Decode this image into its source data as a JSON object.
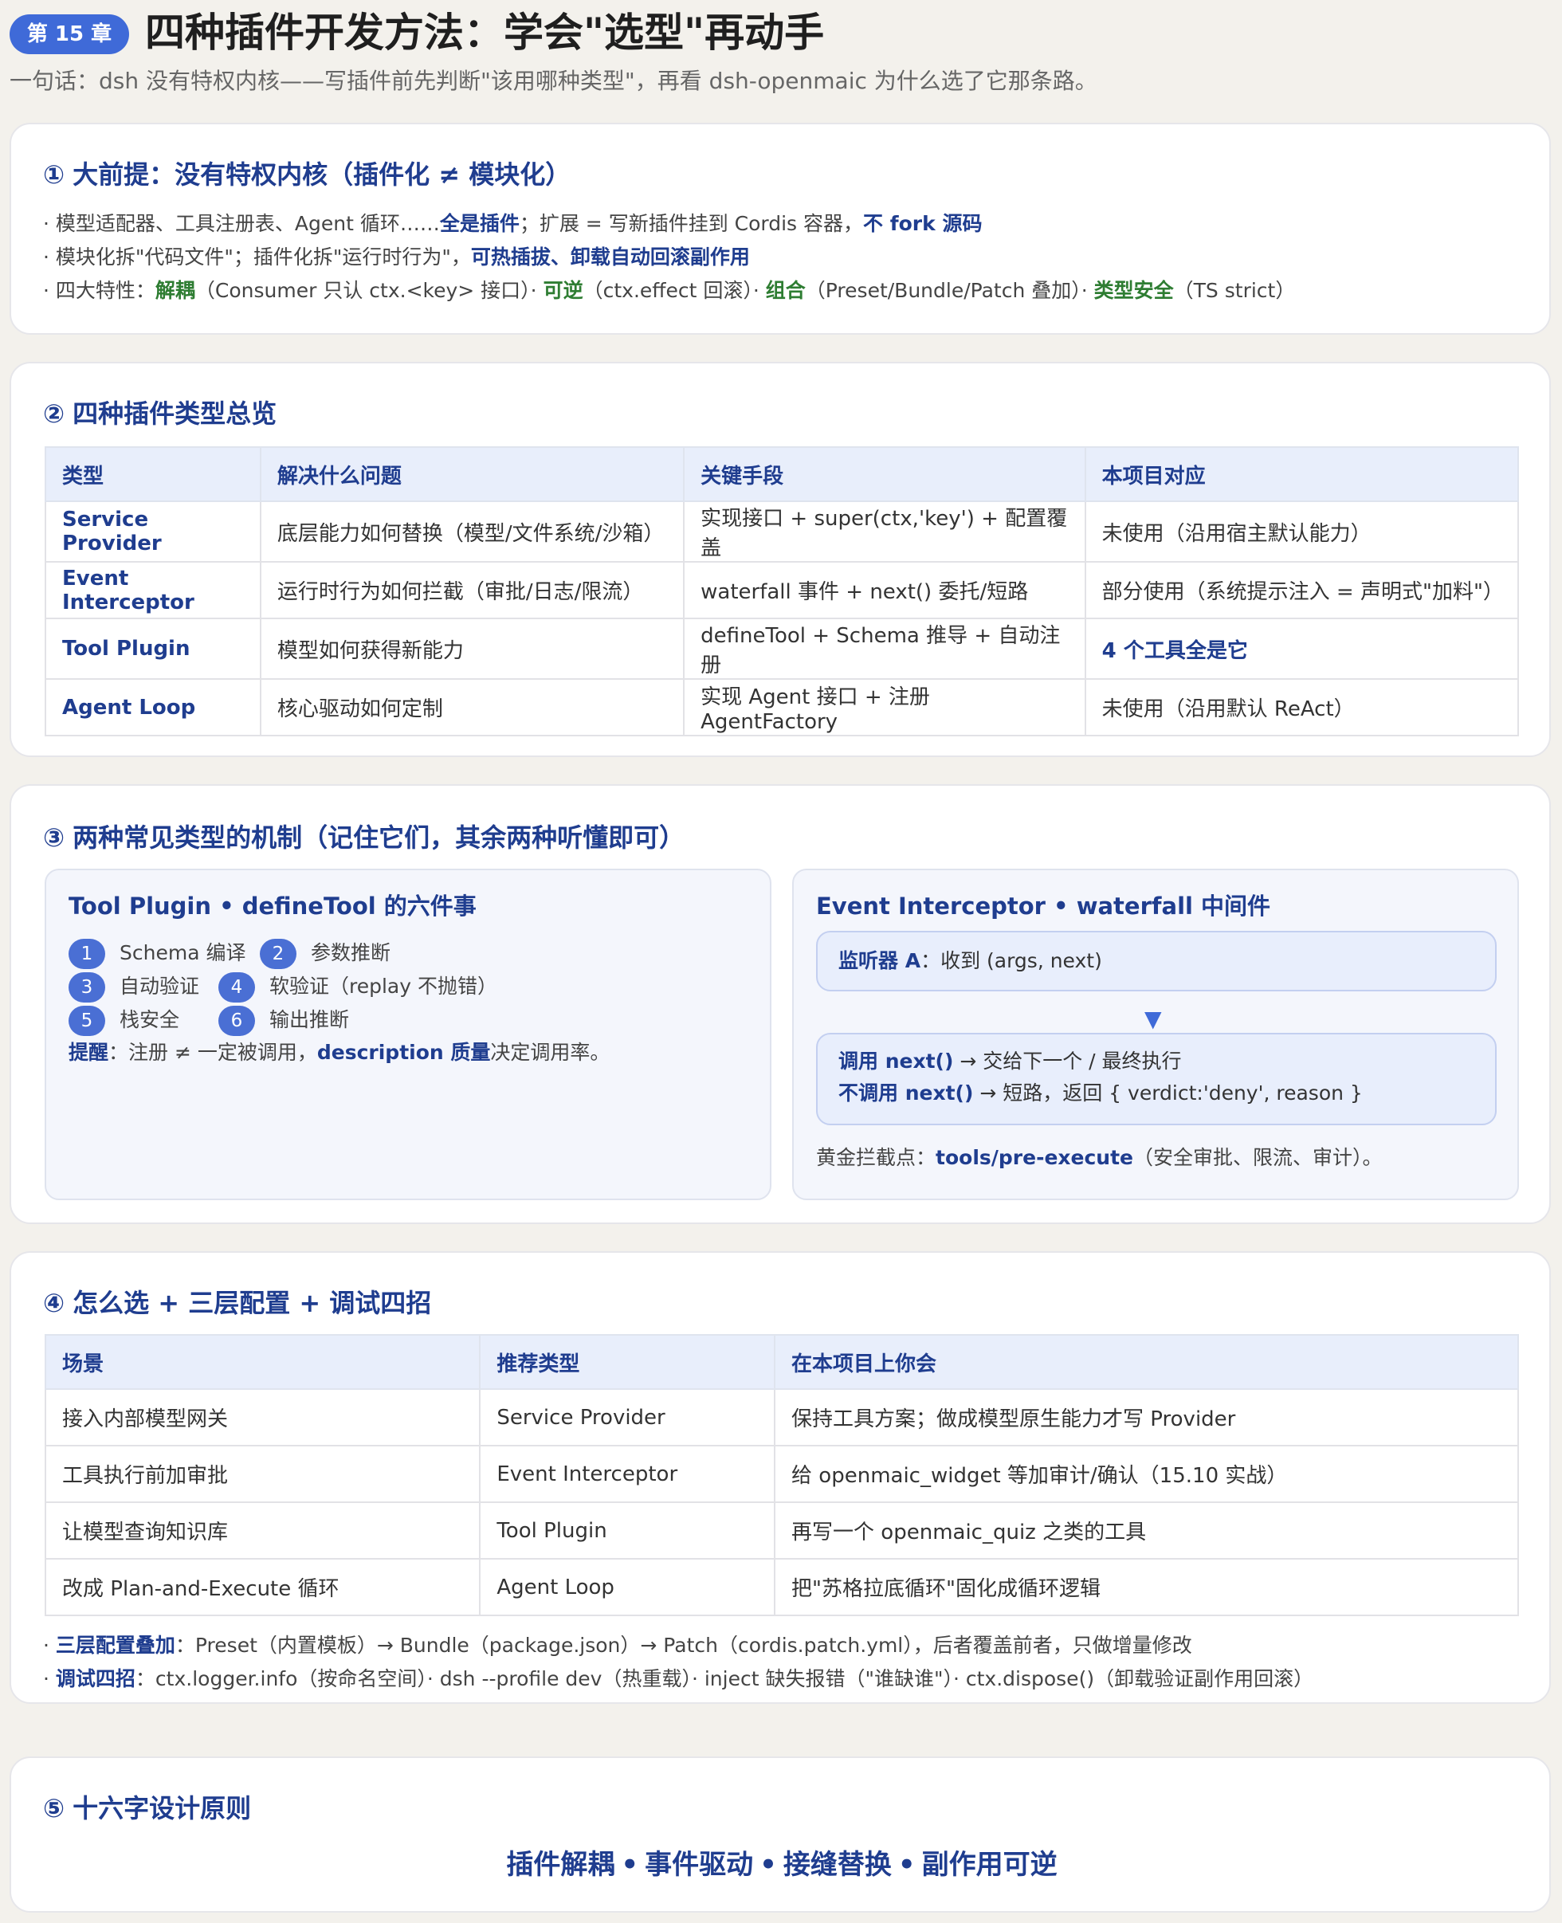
{
  "header": {
    "chip": "第 15 章",
    "title": "四种插件开发方法：学会\"选型\"再动手",
    "subtitle": "一句话：dsh 没有特权内核——写插件前先判断\"该用哪种类型\"，再看 dsh-openmaic 为什么选了它那条路。"
  },
  "s1": {
    "num": "①",
    "title": "大前提：没有特权内核（插件化 ≠ 模块化）",
    "l1a": "· 模型适配器、工具注册表、Agent 循环……",
    "l1b": "全是插件",
    "l1c": "；扩展 = 写新插件挂到 Cordis 容器，",
    "l1d": "不 fork 源码",
    "l2a": "· 模块化拆\"代码文件\"；插件化拆\"运行时行为\"，",
    "l2b": "可热插拔、卸载自动回滚副作用",
    "l3a": "· 四大特性：",
    "l3b": "解耦",
    "l3c": "（Consumer 只认 ctx.<key> 接口）· ",
    "l3d": "可逆",
    "l3e": "（ctx.effect 回滚）· ",
    "l3f": "组合",
    "l3g": "（Preset/Bundle/Patch 叠加）· ",
    "l3h": "类型安全",
    "l3i": "（TS strict）"
  },
  "s2": {
    "num": "②",
    "title": "四种插件类型总览",
    "headers": [
      "类型",
      "解决什么问题",
      "关键手段",
      "本项目对应"
    ],
    "rows": [
      [
        "Service Provider",
        "底层能力如何替换（模型/文件系统/沙箱）",
        "实现接口 + super(ctx,'key') + 配置覆盖",
        "未使用（沿用宿主默认能力）"
      ],
      [
        "Event Interceptor",
        "运行时行为如何拦截（审批/日志/限流）",
        "waterfall 事件 + next() 委托/短路",
        "部分使用（系统提示注入 = 声明式\"加料\"）"
      ],
      [
        "Tool Plugin",
        "模型如何获得新能力",
        "defineTool + Schema 推导 + 自动注册",
        "4 个工具全是它"
      ],
      [
        "Agent Loop",
        "核心驱动如何定制",
        "实现 Agent 接口 + 注册 AgentFactory",
        "未使用（沿用默认 ReAct）"
      ]
    ]
  },
  "s3": {
    "num": "③",
    "title": "两种常见类型的机制（记住它们，其余两种听懂即可）",
    "left": {
      "title": "Tool Plugin • defineTool 的六件事",
      "items": [
        {
          "n": "1",
          "t": "Schema 编译"
        },
        {
          "n": "2",
          "t": "参数推断"
        },
        {
          "n": "3",
          "t": "自动验证"
        },
        {
          "n": "4",
          "t": "软验证（replay 不抛错）"
        },
        {
          "n": "5",
          "t": "栈安全"
        },
        {
          "n": "6",
          "t": "输出推断"
        }
      ],
      "tip_a": "提醒",
      "tip_b": "：注册 ≠ 一定被调用，",
      "tip_c": "description 质量",
      "tip_d": "决定调用率。"
    },
    "right": {
      "title": "Event Interceptor • waterfall 中间件",
      "box1a": "监听器 A",
      "box1b": "：收到 (args, next)",
      "arrow": "▼",
      "box2a": "调用 next()",
      "box2b": " → 交给下一个 / 最终执行",
      "box2c": "不调用 next()",
      "box2d": " → 短路，返回 { verdict:'deny', reason }",
      "foot_a": "黄金拦截点：",
      "foot_b": "tools/pre-execute",
      "foot_c": "（安全审批、限流、审计）。"
    }
  },
  "s4": {
    "num": "④",
    "title": "怎么选 + 三层配置 + 调试四招",
    "headers": [
      "场景",
      "推荐类型",
      "在本项目上你会"
    ],
    "rows": [
      [
        "接入内部模型网关",
        "Service Provider",
        "保持工具方案；做成模型原生能力才写 Provider"
      ],
      [
        "工具执行前加审批",
        "Event Interceptor",
        "给 openmaic_widget 等加审计/确认（15.10 实战）"
      ],
      [
        "让模型查询知识库",
        "Tool Plugin",
        "再写一个 openmaic_quiz 之类的工具"
      ],
      [
        "改成 Plan-and-Execute 循环",
        "Agent Loop",
        "把\"苏格拉底循环\"固化成循环逻辑"
      ]
    ],
    "b1a": "三层配置叠加",
    "b1b": "：Preset（内置模板）→ Bundle（package.json）→ Patch（cordis.patch.yml），后者覆盖前者，只做增量修改",
    "b2a": "调试四招",
    "b2b": "：ctx.logger.info（按命名空间）· dsh --profile dev（热重载）· inject 缺失报错（\"谁缺谁\"）· ctx.dispose()（卸载验证副作用回滚）"
  },
  "s5": {
    "num": "⑤",
    "title": "十六字设计原则",
    "m1": "插件解耦",
    "m2": "事件驱动",
    "m3": "接缝替换",
    "m4": "副作用可逆",
    "sep": "•"
  }
}
